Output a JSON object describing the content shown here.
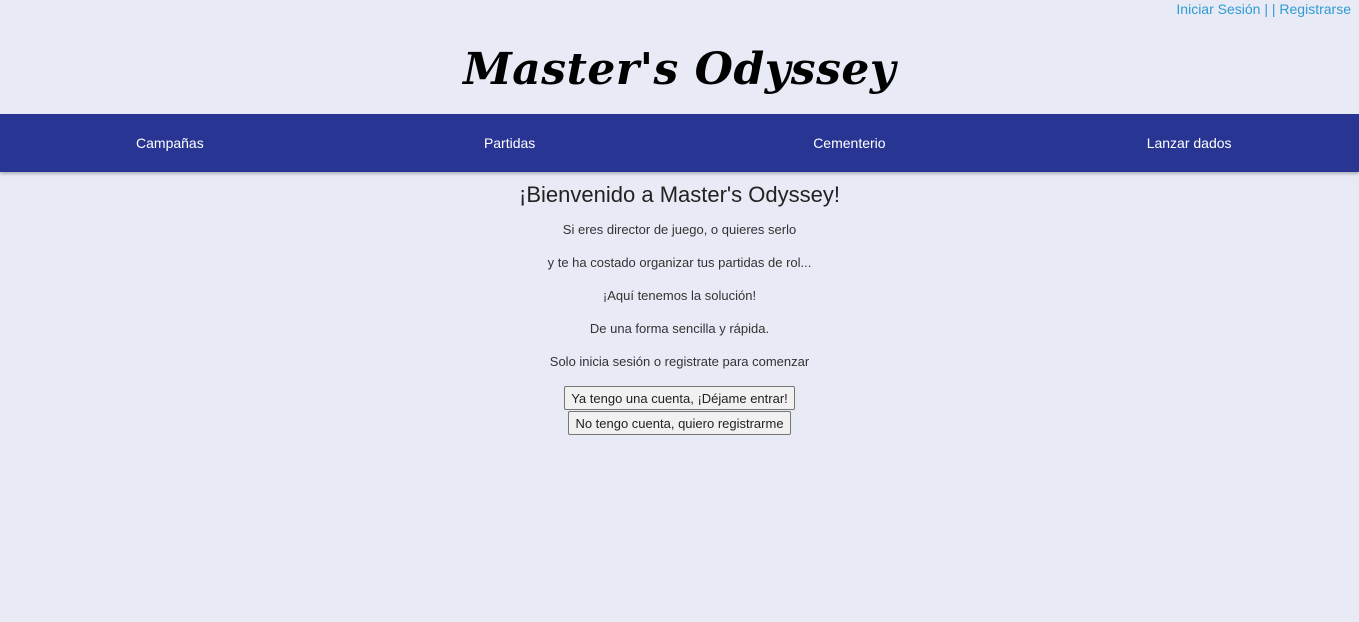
{
  "auth": {
    "login_label": "Iniciar Sesión",
    "separator": "| |",
    "register_label": "Registrarse"
  },
  "brand": {
    "title": "Master's Odyssey"
  },
  "nav": {
    "items": [
      {
        "label": "Campañas"
      },
      {
        "label": "Partidas"
      },
      {
        "label": "Cementerio"
      },
      {
        "label": "Lanzar dados"
      }
    ]
  },
  "main": {
    "heading": "¡Bienvenido a Master's Odyssey!",
    "lines": [
      "Si eres director de juego, o quieres serlo",
      "y te ha costado organizar tus partidas de rol...",
      "¡Aquí tenemos la solución!",
      "De una forma sencilla y rápida.",
      "Solo inicia sesión o registrate para comenzar"
    ],
    "login_button": "Ya tengo una cuenta, ¡Déjame entrar!",
    "register_button": "No tengo cuenta, quiero registrarme"
  },
  "colors": {
    "background": "#e8ebf6",
    "navbar": "#283593",
    "link": "#2f9bd3"
  }
}
